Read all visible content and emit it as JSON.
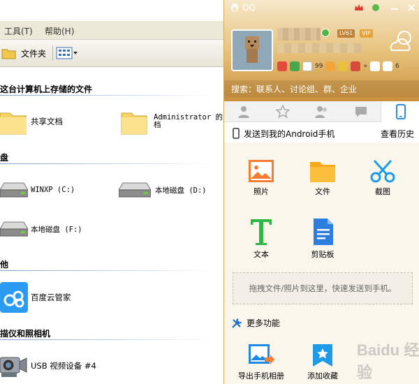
{
  "explorer": {
    "menu": [
      {
        "label": "工具(T)"
      },
      {
        "label": "帮助(H)"
      }
    ],
    "toolbar": {
      "folders_label": "文件夹"
    },
    "sections": [
      {
        "header": "这台计算机上存储的文件"
      },
      {
        "header": "盘"
      },
      {
        "header": "他"
      },
      {
        "header": "描仪和照相机"
      }
    ],
    "items": [
      {
        "label": "共享文档"
      },
      {
        "label": "Administrator 的"
      },
      {
        "label": "档"
      },
      {
        "label": "WINXP (C:)"
      },
      {
        "label": "本地磁盘 (D:)"
      },
      {
        "label": "本地磁盘 (F:)"
      },
      {
        "label": "百度云管家"
      },
      {
        "label": "USB 视频设备 #4"
      }
    ]
  },
  "qq": {
    "title": "QQ",
    "level": "LV61",
    "vip": "VIP",
    "message_count": "99",
    "apps_count": "6",
    "search_placeholder": "搜索：联系人、讨论组、群、企业",
    "send_to": "发送到我的Android手机",
    "history": "查看历史",
    "tools": [
      {
        "label": "照片"
      },
      {
        "label": "文件"
      },
      {
        "label": "截图"
      },
      {
        "label": "文本"
      },
      {
        "label": "剪贴板"
      }
    ],
    "drop_hint": "拖拽文件/照片到这里，快速发送到手机。",
    "more_label": "更多功能",
    "bottom_tools": [
      {
        "label": "导出手机相册"
      },
      {
        "label": "添加收藏"
      }
    ],
    "watermark": "Baidu 经验"
  }
}
